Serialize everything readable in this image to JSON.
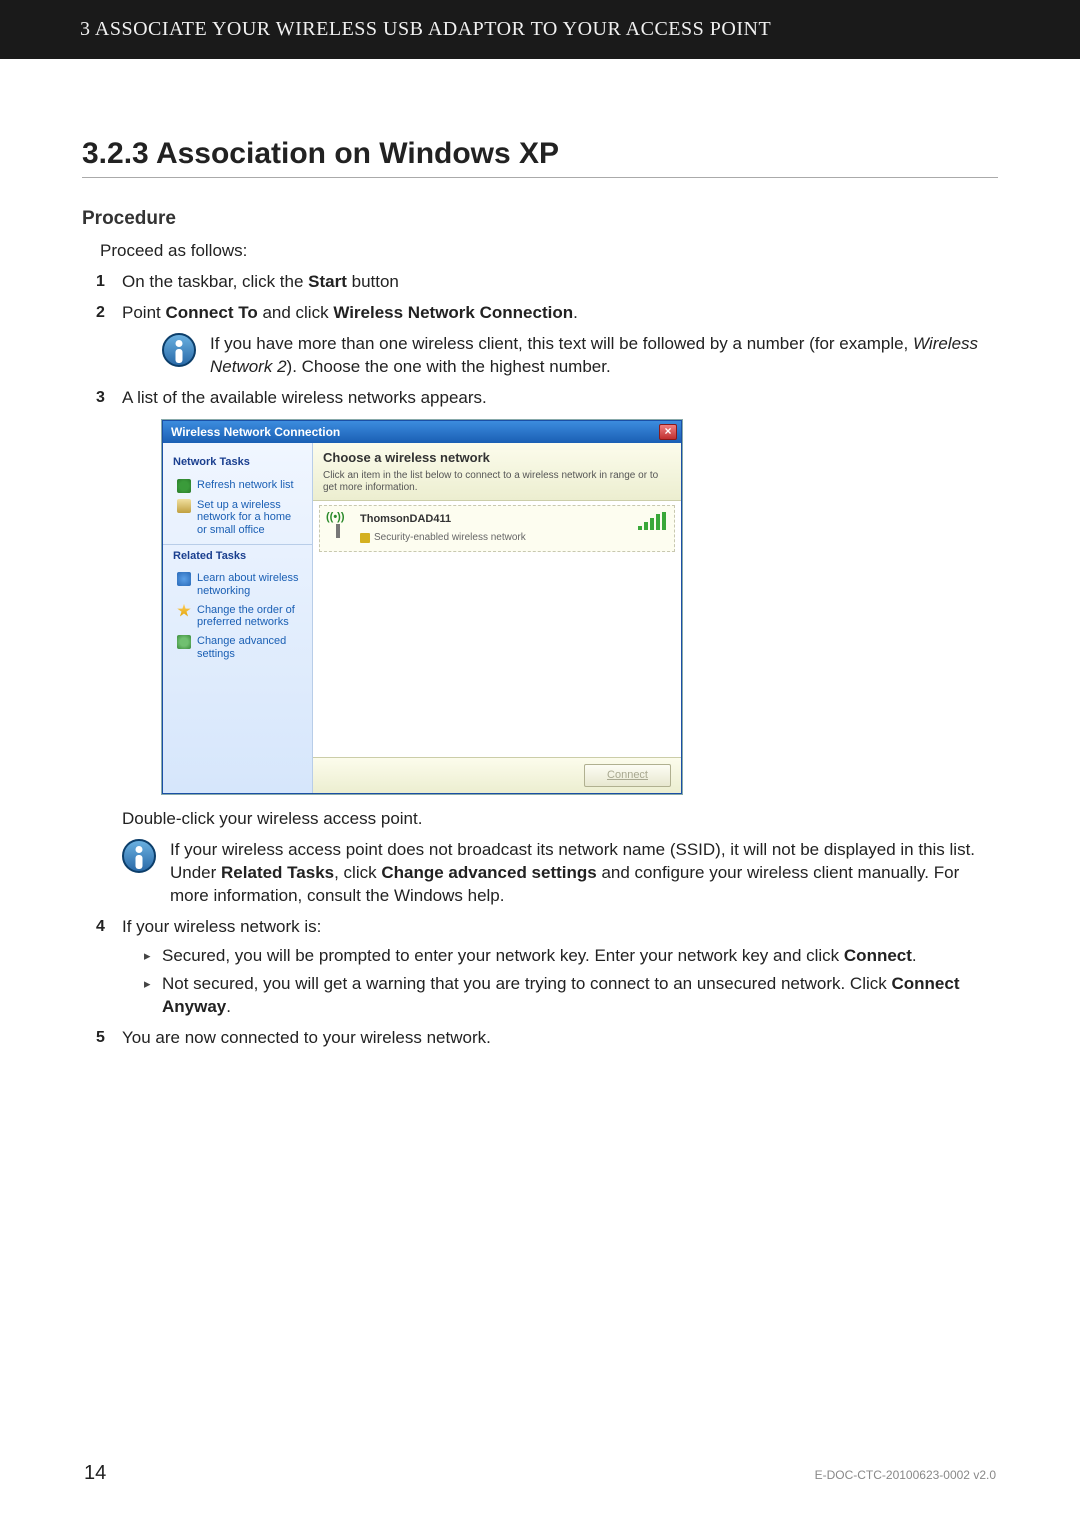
{
  "header": {
    "chapter_line": "3 ASSOCIATE YOUR WIRELESS USB ADAPTOR TO YOUR ACCESS POINT"
  },
  "section": {
    "number_title": "3.2.3  Association on Windows XP",
    "subhead": "Procedure",
    "intro": "Proceed as follows:"
  },
  "steps": {
    "s1": {
      "num": "1",
      "pre": "On the taskbar, click the ",
      "b1": "Start",
      "post": " button"
    },
    "s2": {
      "num": "2",
      "pre": "Point ",
      "b1": "Connect To",
      "mid": " and click ",
      "b2": "Wireless Network Connection",
      "post": "."
    },
    "s2_note": {
      "pre": "If you have more than one wireless client, this text will be followed by a number (for example, ",
      "i1": "Wireless Network 2",
      "post": "). Choose the one with the highest number."
    },
    "s3": {
      "num": "3",
      "text": "A list of the available wireless networks appears."
    },
    "s3_tail": "Double-click your wireless access point.",
    "s3_note": {
      "pre": "If your wireless access point does not broadcast its network name (SSID), it will not be displayed in this list. Under ",
      "b1": "Related Tasks",
      "mid1": ", click ",
      "b2": "Change advanced settings",
      "post": " and configure your wireless client manually. For more information, consult the Windows help."
    },
    "s4": {
      "num": "4",
      "text": "If your wireless network is:"
    },
    "s4_a": {
      "pre": "Secured, you will be prompted to enter your network key. Enter your network key and click ",
      "b1": "Connect",
      "post": "."
    },
    "s4_b": {
      "pre": "Not secured, you will get a warning that you are trying to connect to an unsecured network. Click ",
      "b1": "Connect Anyway",
      "post": "."
    },
    "s5": {
      "num": "5",
      "text": "You are now connected to your wireless network."
    }
  },
  "xp": {
    "title": "Wireless Network Connection",
    "close": "×",
    "side": {
      "group1": "Network Tasks",
      "refresh": "Refresh network list",
      "setup": "Set up a wireless network for a home or small office",
      "group2": "Related Tasks",
      "learn": "Learn about wireless networking",
      "order": "Change the order of preferred networks",
      "adv": "Change advanced settings"
    },
    "main": {
      "title": "Choose a wireless network",
      "sub": "Click an item in the list below to connect to a wireless network in range or to get more information.",
      "net_name": "ThomsonDAD411",
      "net_sec": "Security-enabled wireless network",
      "connect": "Connect"
    }
  },
  "footer": {
    "page": "14",
    "docid": "E-DOC-CTC-20100623-0002 v2.0"
  }
}
